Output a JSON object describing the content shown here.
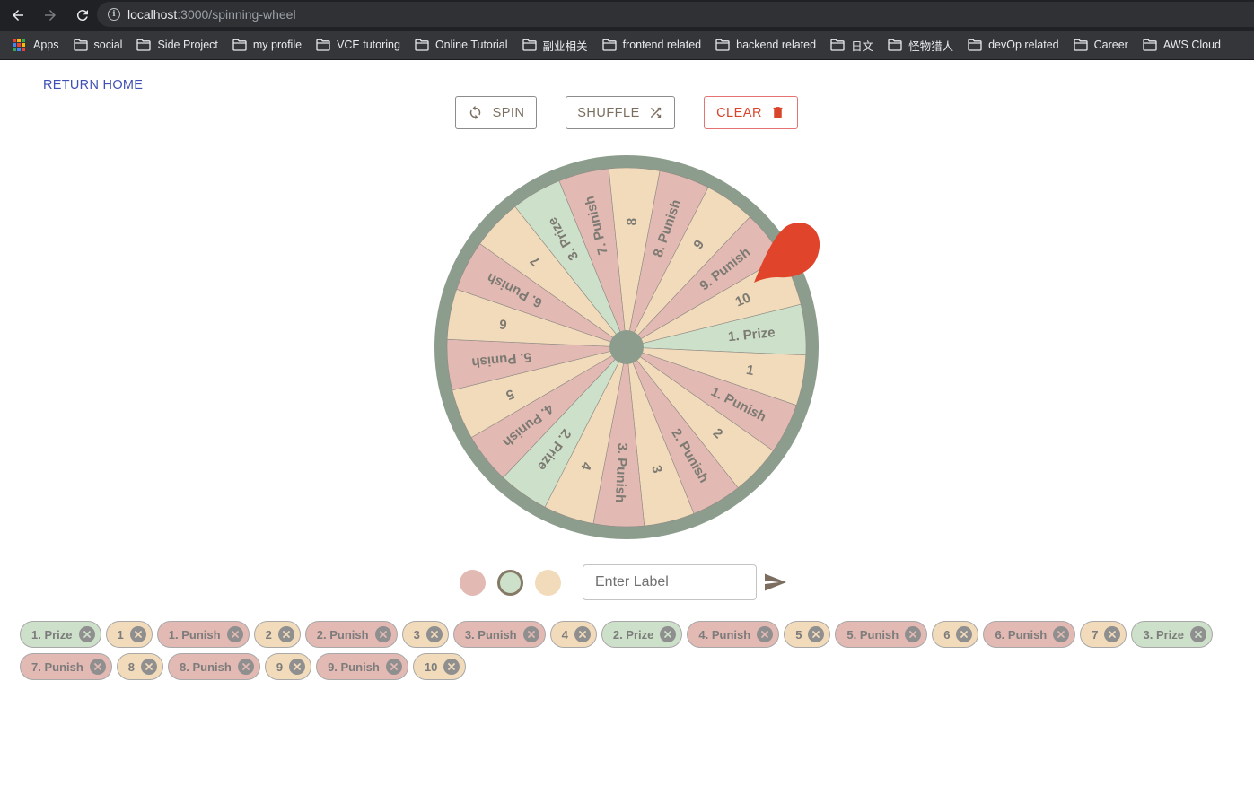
{
  "browser": {
    "url_host": "localhost",
    "url_path": ":3000/spinning-wheel",
    "bookmarks": [
      {
        "label": "Apps",
        "type": "apps"
      },
      {
        "label": "social",
        "type": "folder"
      },
      {
        "label": "Side Project",
        "type": "folder"
      },
      {
        "label": "my profile",
        "type": "folder"
      },
      {
        "label": "VCE tutoring",
        "type": "folder"
      },
      {
        "label": "Online Tutorial",
        "type": "folder"
      },
      {
        "label": "副业相关",
        "type": "folder"
      },
      {
        "label": "frontend related",
        "type": "folder"
      },
      {
        "label": "backend related",
        "type": "folder"
      },
      {
        "label": "日文",
        "type": "folder"
      },
      {
        "label": "怪物猎人",
        "type": "folder"
      },
      {
        "label": "devOp related",
        "type": "folder"
      },
      {
        "label": "Career",
        "type": "folder"
      },
      {
        "label": "AWS Cloud",
        "type": "folder"
      }
    ]
  },
  "page": {
    "return_home": "RETURN HOME",
    "buttons": {
      "spin": "SPIN",
      "shuffle": "SHUFFLE",
      "clear": "CLEAR"
    },
    "input_placeholder": "Enter Label",
    "colors": {
      "red": "#e2b9b3",
      "green": "#cde0c9",
      "peach": "#f2dbbb",
      "rim": "#8d9d8d",
      "pointer": "#e0452b",
      "accent_text": "#7b6e60",
      "clear_red": "#d8452a",
      "link_blue": "#3f51b5"
    },
    "color_options": [
      {
        "color": "red",
        "selected": false
      },
      {
        "color": "green",
        "selected": true
      },
      {
        "color": "peach",
        "selected": false
      }
    ]
  },
  "wheel": {
    "start_angle_deg": -13.85,
    "segments": [
      {
        "label": "1. Prize",
        "color": "green"
      },
      {
        "label": "1",
        "color": "peach"
      },
      {
        "label": "1. Punish",
        "color": "red"
      },
      {
        "label": "2",
        "color": "peach"
      },
      {
        "label": "2. Punish",
        "color": "red"
      },
      {
        "label": "3",
        "color": "peach"
      },
      {
        "label": "3. Punish",
        "color": "red"
      },
      {
        "label": "4",
        "color": "peach"
      },
      {
        "label": "2. Prize",
        "color": "green"
      },
      {
        "label": "4. Punish",
        "color": "red"
      },
      {
        "label": "5",
        "color": "peach"
      },
      {
        "label": "5. Punish",
        "color": "red"
      },
      {
        "label": "6",
        "color": "peach"
      },
      {
        "label": "6. Punish",
        "color": "red"
      },
      {
        "label": "7",
        "color": "peach"
      },
      {
        "label": "3. Prize",
        "color": "green"
      },
      {
        "label": "7. Punish",
        "color": "red"
      },
      {
        "label": "8",
        "color": "peach"
      },
      {
        "label": "8. Punish",
        "color": "red"
      },
      {
        "label": "9",
        "color": "peach"
      },
      {
        "label": "9. Punish",
        "color": "red"
      },
      {
        "label": "10",
        "color": "peach"
      }
    ]
  },
  "chips": [
    {
      "label": "1. Prize",
      "color": "green"
    },
    {
      "label": "1",
      "color": "peach"
    },
    {
      "label": "1. Punish",
      "color": "red"
    },
    {
      "label": "2",
      "color": "peach"
    },
    {
      "label": "2. Punish",
      "color": "red"
    },
    {
      "label": "3",
      "color": "peach"
    },
    {
      "label": "3. Punish",
      "color": "red"
    },
    {
      "label": "4",
      "color": "peach"
    },
    {
      "label": "2. Prize",
      "color": "green"
    },
    {
      "label": "4. Punish",
      "color": "red"
    },
    {
      "label": "5",
      "color": "peach"
    },
    {
      "label": "5. Punish",
      "color": "red"
    },
    {
      "label": "6",
      "color": "peach"
    },
    {
      "label": "6. Punish",
      "color": "red"
    },
    {
      "label": "7",
      "color": "peach"
    },
    {
      "label": "3. Prize",
      "color": "green"
    },
    {
      "label": "7. Punish",
      "color": "red"
    },
    {
      "label": "8",
      "color": "peach"
    },
    {
      "label": "8. Punish",
      "color": "red"
    },
    {
      "label": "9",
      "color": "peach"
    },
    {
      "label": "9. Punish",
      "color": "red"
    },
    {
      "label": "10",
      "color": "peach"
    }
  ]
}
